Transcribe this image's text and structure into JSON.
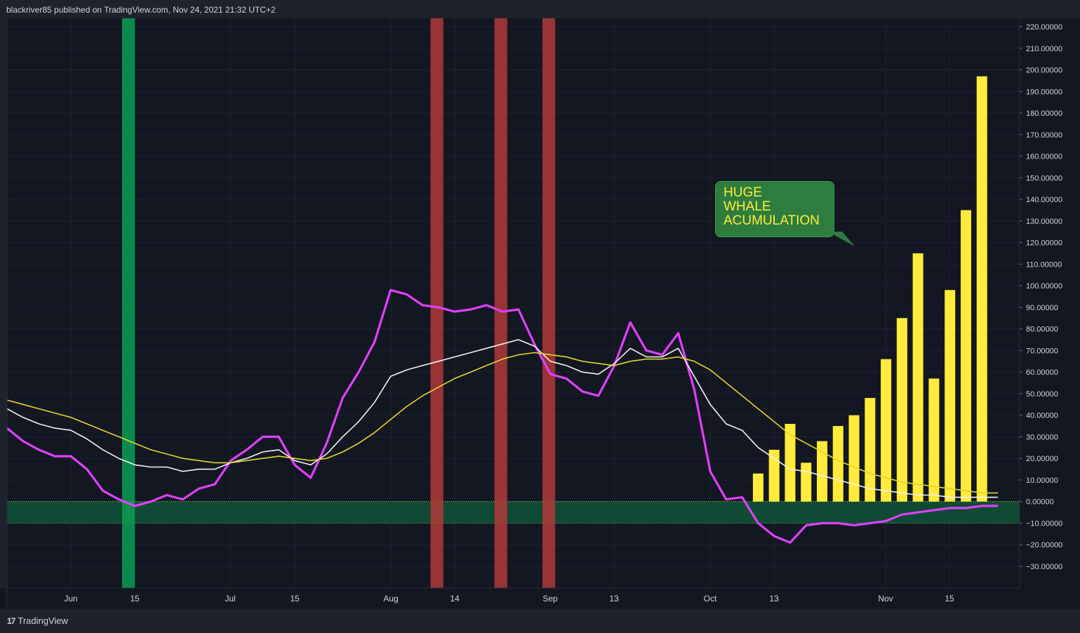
{
  "header": {
    "publisher_line": "blackriver85 published on TradingView.com, Nov 24, 2021 21:32 UTC+2"
  },
  "footer": {
    "brand_text": "TradingView",
    "brand_mark": "17"
  },
  "annotation": {
    "lines": [
      "HUGE",
      "WHALE",
      "ACUMULATION"
    ],
    "bg_color": "#2e7d3e",
    "text_color": "#ffeb3b"
  },
  "chart_data": {
    "type": "line",
    "title": "",
    "xlabel": "",
    "ylabel": "",
    "ylim": [
      -40,
      224
    ],
    "x_ticks": [
      "Jun",
      "15",
      "Jul",
      "15",
      "Aug",
      "14",
      "Sep",
      "13",
      "Oct",
      "13",
      "Nov",
      "15"
    ],
    "y_ticks": [
      "220.00000",
      "210.00000",
      "200.00000",
      "190.00000",
      "180.00000",
      "170.00000",
      "160.00000",
      "150.00000",
      "140.00000",
      "130.00000",
      "120.00000",
      "110.00000",
      "100.00000",
      "90.00000",
      "80.00000",
      "70.00000",
      "60.00000",
      "50.00000",
      "40.00000",
      "30.00000",
      "20.00000",
      "10.00000",
      "0.00000",
      "−10.00000",
      "−20.00000",
      "−30.00000"
    ],
    "grid": true,
    "zones": [
      {
        "name": "accumulation-band",
        "y_from": -10,
        "y_to": 0,
        "color": "#0e4a34"
      }
    ],
    "highlight_bars": [
      {
        "x_from": 7.2,
        "x_to": 8.0,
        "color": "#0c9d55"
      },
      {
        "x_from": 26.5,
        "x_to": 27.3,
        "color": "#b03a3a"
      },
      {
        "x_from": 30.5,
        "x_to": 31.3,
        "color": "#b03a3a"
      },
      {
        "x_from": 33.5,
        "x_to": 34.3,
        "color": "#b03a3a"
      }
    ],
    "series": [
      {
        "color": "#e040fb",
        "width": 3.2,
        "kind": "line",
        "x": [
          0,
          1,
          2,
          3,
          4,
          5,
          6,
          7,
          8,
          9,
          10,
          11,
          12,
          13,
          14,
          15,
          16,
          17,
          18,
          19,
          20,
          21,
          22,
          23,
          24,
          25,
          26,
          27,
          28,
          29,
          30,
          31,
          32,
          33,
          34,
          35,
          36,
          37,
          38,
          39,
          40,
          41,
          42,
          43,
          44,
          45,
          46,
          47,
          48,
          49,
          50,
          51,
          52,
          53,
          54,
          55,
          56,
          57,
          58,
          59,
          60,
          61,
          62
        ],
        "y": [
          34,
          28,
          24,
          21,
          21,
          15,
          5,
          1,
          -2,
          0,
          3,
          1,
          6,
          8,
          19,
          24,
          30,
          30,
          17,
          11,
          27,
          48,
          60,
          74,
          98,
          96,
          91,
          90,
          88,
          89,
          91,
          88,
          89,
          73,
          59,
          57,
          51,
          49,
          63,
          83,
          70,
          68,
          78,
          52,
          14,
          1,
          2,
          -10,
          -16,
          -19,
          -11,
          -10,
          -10,
          -11,
          -10,
          -9,
          -6,
          -5,
          -4,
          -3,
          -3,
          -2,
          -2
        ]
      },
      {
        "color": "#f2f2f2",
        "width": 1.6,
        "kind": "line",
        "x": [
          0,
          1,
          2,
          3,
          4,
          5,
          6,
          7,
          8,
          9,
          10,
          11,
          12,
          13,
          14,
          15,
          16,
          17,
          18,
          19,
          20,
          21,
          22,
          23,
          24,
          25,
          26,
          27,
          28,
          29,
          30,
          31,
          32,
          33,
          34,
          35,
          36,
          37,
          38,
          39,
          40,
          41,
          42,
          43,
          44,
          45,
          46,
          47,
          48,
          49,
          50,
          51,
          52,
          53,
          54,
          55,
          56,
          57,
          58,
          59,
          60,
          61,
          62
        ],
        "y": [
          43,
          39,
          36,
          34,
          33,
          29,
          24,
          20,
          17,
          16,
          16,
          14,
          15,
          15,
          18,
          20,
          23,
          24,
          19,
          17,
          22,
          30,
          37,
          46,
          58,
          61,
          63,
          65,
          67,
          69,
          71,
          73,
          75,
          72,
          65,
          63,
          60,
          59,
          64,
          71,
          67,
          67,
          71,
          58,
          45,
          36,
          33,
          25,
          20,
          15,
          14,
          12,
          10,
          8,
          6,
          5,
          4,
          3,
          3,
          2,
          2,
          2,
          2
        ]
      },
      {
        "color": "#e6d32e",
        "width": 1.6,
        "kind": "line",
        "x": [
          0,
          1,
          2,
          3,
          4,
          5,
          6,
          7,
          8,
          9,
          10,
          11,
          12,
          13,
          14,
          15,
          16,
          17,
          18,
          19,
          20,
          21,
          22,
          23,
          24,
          25,
          26,
          27,
          28,
          29,
          30,
          31,
          32,
          33,
          34,
          35,
          36,
          37,
          38,
          39,
          40,
          41,
          42,
          43,
          44,
          45,
          46,
          47,
          48,
          49,
          50,
          51,
          52,
          53,
          54,
          55,
          56,
          57,
          58,
          59,
          60,
          61,
          62
        ],
        "y": [
          47,
          45,
          43,
          41,
          39,
          36,
          33,
          30,
          27,
          24,
          22,
          20,
          19,
          18,
          18,
          19,
          20,
          21,
          20,
          19,
          20,
          23,
          27,
          32,
          38,
          44,
          49,
          53,
          57,
          60,
          63,
          66,
          68,
          69,
          68,
          67,
          65,
          64,
          63,
          65,
          66,
          66,
          67,
          65,
          61,
          55,
          49,
          43,
          37,
          31,
          27,
          23,
          19,
          16,
          13,
          11,
          9,
          8,
          7,
          6,
          5,
          4,
          4
        ]
      },
      {
        "color": "#ffeb3b",
        "kind": "bar",
        "x": [
          47,
          48,
          49,
          50,
          51,
          52,
          53,
          54,
          55,
          56,
          57,
          58,
          59,
          60,
          61,
          62
        ],
        "y": [
          13,
          24,
          36,
          18,
          28,
          35,
          40,
          48,
          66,
          85,
          115,
          57,
          98,
          135,
          197,
          0
        ]
      }
    ]
  }
}
